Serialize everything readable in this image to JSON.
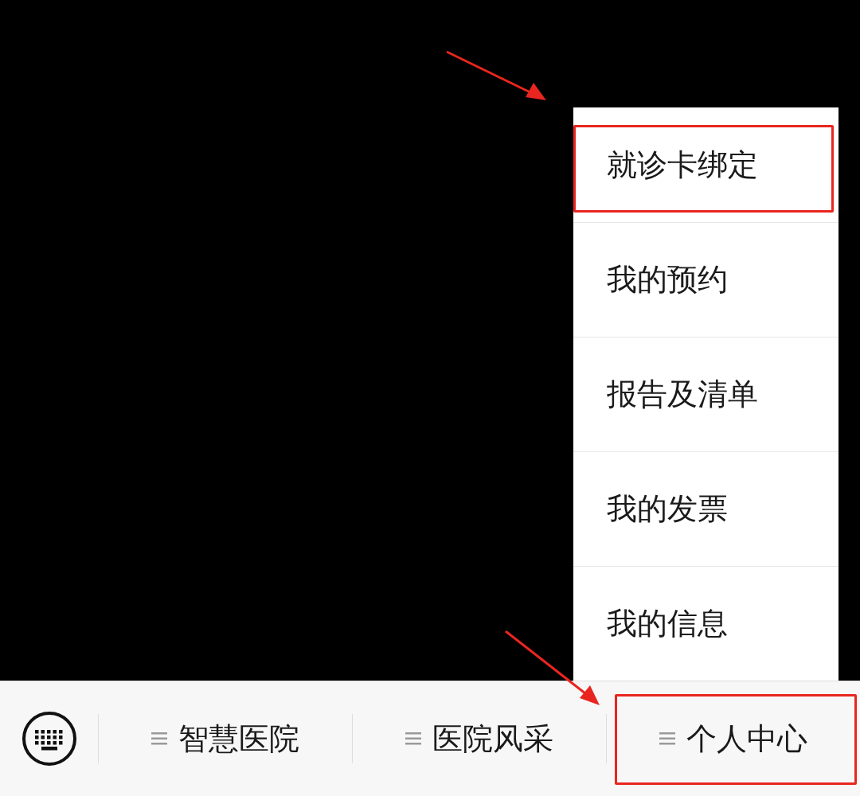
{
  "popup_menu": {
    "items": [
      {
        "label": "就诊卡绑定",
        "annotated": true
      },
      {
        "label": "我的预约",
        "annotated": false
      },
      {
        "label": "报告及清单",
        "annotated": false
      },
      {
        "label": "我的发票",
        "annotated": false
      },
      {
        "label": "我的信息",
        "annotated": false
      }
    ]
  },
  "bottom_menu": {
    "items": [
      {
        "label": "智慧医院",
        "annotated": false
      },
      {
        "label": "医院风采",
        "annotated": false
      },
      {
        "label": "个人中心",
        "annotated": true
      }
    ]
  }
}
